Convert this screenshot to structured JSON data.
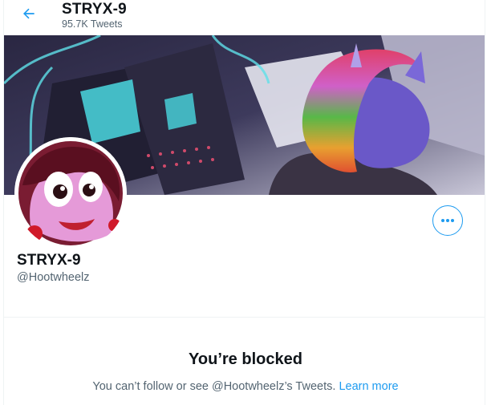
{
  "header": {
    "back_icon": "arrow-left-icon",
    "title": "STRYX-9",
    "subtitle": "95.7K Tweets"
  },
  "banner": {
    "kind": "profile-header-image"
  },
  "profile": {
    "avatar_kind": "profile-picture",
    "more_icon": "ellipsis-icon",
    "name": "STRYX-9",
    "handle": "@Hootwheelz"
  },
  "blocked": {
    "title": "You’re blocked",
    "message": "You can’t follow or see @Hootwheelz’s Tweets.",
    "link": "Learn more"
  },
  "colors": {
    "accent": "#1d9bf0",
    "secondary_text": "#536471",
    "primary_text": "#0f1419",
    "divider": "#eff3f4"
  }
}
